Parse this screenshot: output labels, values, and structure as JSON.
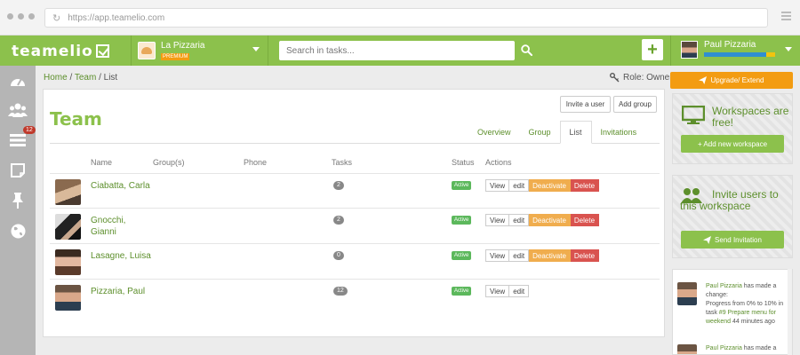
{
  "browser": {
    "url": "https://app.teamelio.com"
  },
  "header": {
    "logo": "teamelio",
    "workspace": {
      "name": "La Pizzaria",
      "badge": "PREMIUM"
    },
    "search": {
      "placeholder": "Search in tasks...",
      "value": ""
    },
    "add_label": "+",
    "user": {
      "name": "Paul Pizzaria",
      "progress": 0.9
    }
  },
  "sidebar": {
    "items": [
      {
        "icon": "dashboard-icon"
      },
      {
        "icon": "users-icon"
      },
      {
        "icon": "tasks-icon",
        "count": "12"
      },
      {
        "icon": "notes-icon"
      },
      {
        "icon": "pin-icon"
      },
      {
        "icon": "globe-icon"
      }
    ]
  },
  "breadcrumb": {
    "home": "Home",
    "sep1": " / ",
    "team": "Team",
    "sep2": " / ",
    "current": "List"
  },
  "role": "Role: Owner",
  "team": {
    "title": "Team",
    "invite_label": "Invite a user",
    "add_group_label": "Add group",
    "tabs": [
      "Overview",
      "Group",
      "List",
      "Invitations"
    ],
    "active_tab": "List",
    "columns": {
      "name": "Name",
      "groups": "Group(s)",
      "phone": "Phone",
      "tasks": "Tasks",
      "status": "Status",
      "actions": "Actions"
    },
    "members": [
      {
        "name": "Ciabatta, Carla",
        "tasks": "2",
        "status": "Active",
        "actions": [
          "View",
          "edit",
          "Deactivate",
          "Delete"
        ]
      },
      {
        "name": "Gnocchi, Gianni",
        "tasks": "2",
        "status": "Active",
        "actions": [
          "View",
          "edit",
          "Deactivate",
          "Delete"
        ]
      },
      {
        "name": "Lasagne, Luisa",
        "tasks": "0",
        "status": "Active",
        "actions": [
          "View",
          "edit",
          "Deactivate",
          "Delete"
        ]
      },
      {
        "name": "Pizzaria, Paul",
        "tasks": "12",
        "status": "Active",
        "actions": [
          "View",
          "edit"
        ]
      }
    ]
  },
  "right": {
    "upgrade_label": "Upgrade/ Extend",
    "promo_workspaces": {
      "title": "Workspaces are free!",
      "button": "+ Add new workspace"
    },
    "promo_invite": {
      "title": "Invite users to this workspace",
      "button": "Send Invitation"
    },
    "feed": [
      {
        "who": "Paul Pizzaria",
        "text": " has made a change:",
        "detail": "Progress from 0% to 10% in task ",
        "task": "#9 Prepare menu for weekend",
        "time": " 44 minutes ago"
      },
      {
        "who": "Paul Pizzaria",
        "text": " has made a",
        "detail": "",
        "task": "",
        "time": ""
      }
    ]
  },
  "colors": {
    "brand_green": "#8cc14c",
    "link_green": "#5d8f2c",
    "orange": "#f39c12",
    "danger": "#d9534f",
    "success": "#5cb85c"
  }
}
